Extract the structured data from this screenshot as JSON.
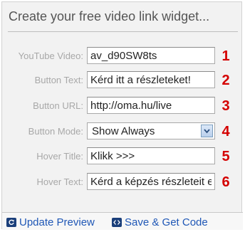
{
  "title": "Create your free video link widget...",
  "fields": [
    {
      "label": "YouTube Video:",
      "value": "av_d90SW8ts",
      "number": "1"
    },
    {
      "label": "Button Text:",
      "value": "Kérd itt a részleteket!",
      "number": "2"
    },
    {
      "label": "Button URL:",
      "value": "http://oma.hu/live",
      "number": "3"
    },
    {
      "label": "Button Mode:",
      "value": "Show Always",
      "number": "4"
    },
    {
      "label": "Hover Title:",
      "value": "Klikk >>>",
      "number": "5"
    },
    {
      "label": "Hover Text:",
      "value": "Kérd a képzés részleteit e",
      "number": "6"
    }
  ],
  "actions": {
    "update_preview": "Update Preview",
    "save_get_code": "Save & Get Code"
  },
  "colors": {
    "number": "#d40000",
    "link": "#1f57b6",
    "label": "#a8a8a8"
  }
}
